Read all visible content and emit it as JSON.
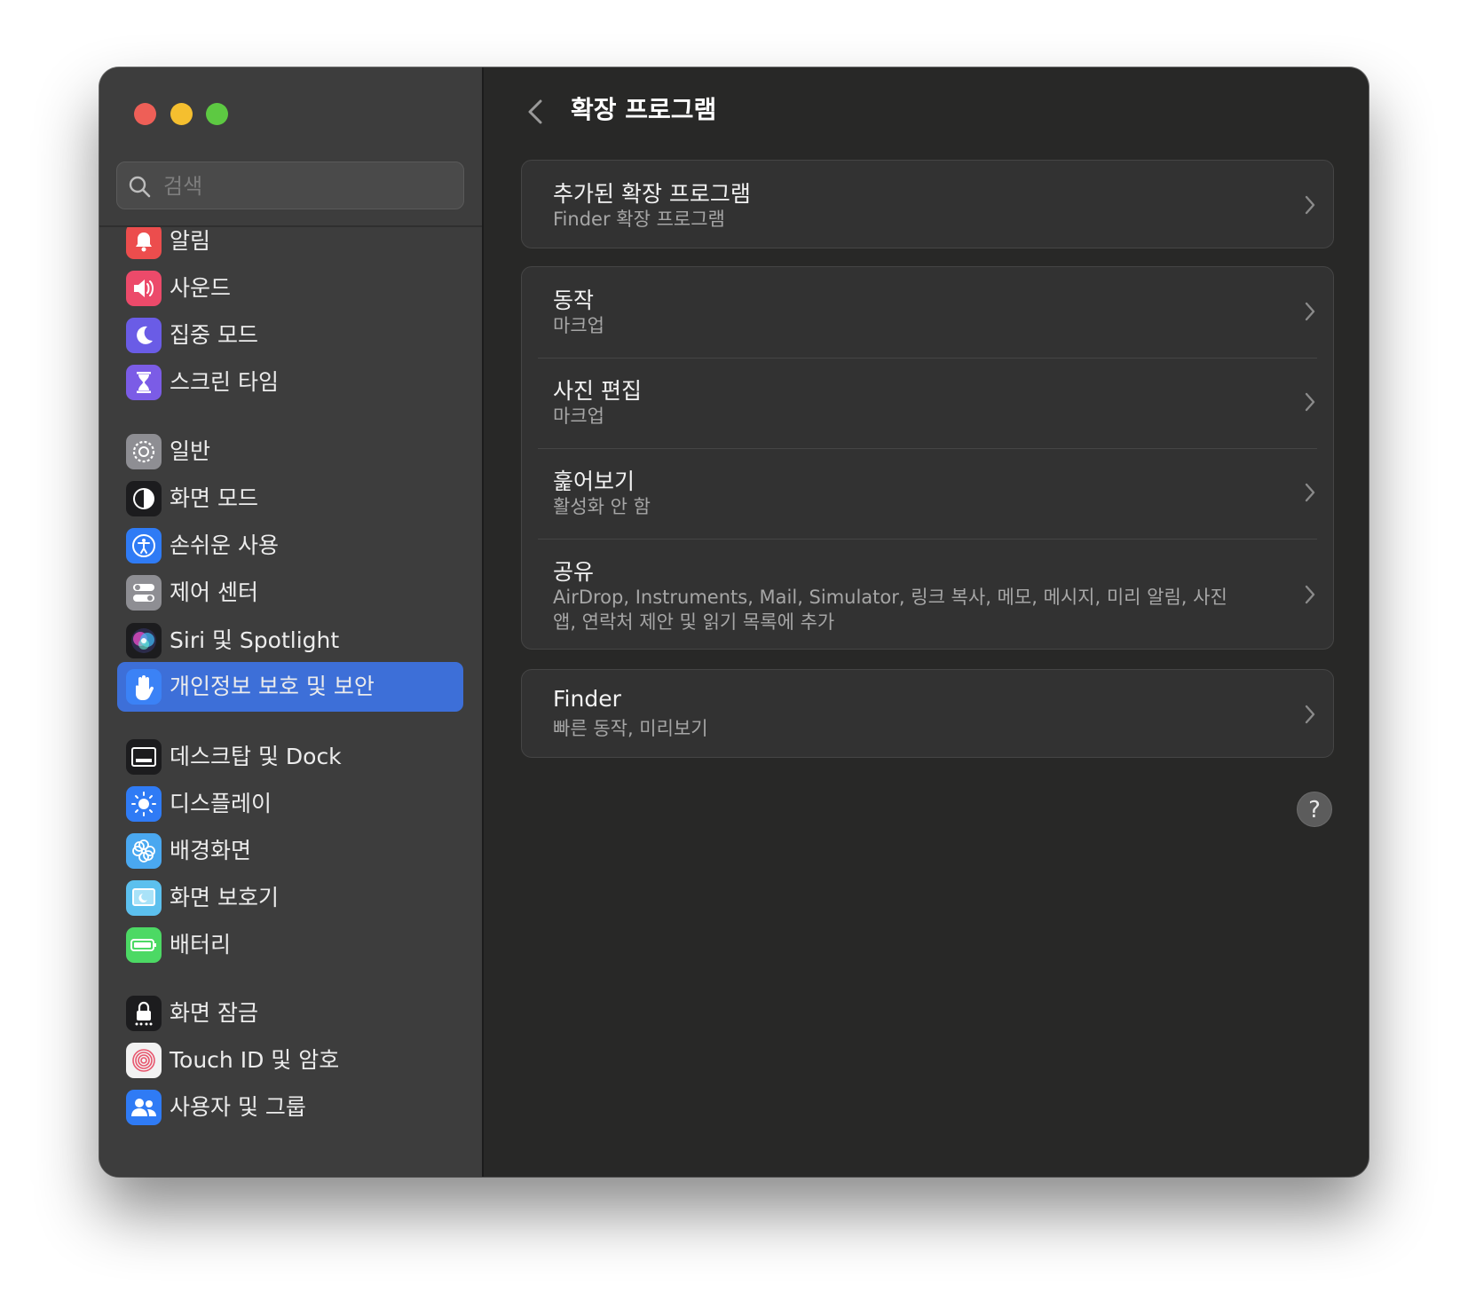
{
  "search": {
    "placeholder": "검색"
  },
  "sidebar": {
    "items": [
      {
        "label": "알림",
        "icon": "bell-icon",
        "icon_bg": "#ec4d4d"
      },
      {
        "label": "사운드",
        "icon": "speaker-icon",
        "icon_bg": "#ec4a6a"
      },
      {
        "label": "집중 모드",
        "icon": "moon-icon",
        "icon_bg": "#6a5ce6"
      },
      {
        "label": "스크린 타임",
        "icon": "hourglass-icon",
        "icon_bg": "#7b5ce6"
      },
      {
        "label": "일반",
        "icon": "gear-icon",
        "icon_bg": "#8e8e93"
      },
      {
        "label": "화면 모드",
        "icon": "appearance-icon",
        "icon_bg": "#1c1c1e"
      },
      {
        "label": "손쉬운 사용",
        "icon": "accessibility-icon",
        "icon_bg": "#2f7bf5"
      },
      {
        "label": "제어 센터",
        "icon": "toggles-icon",
        "icon_bg": "#8e8e93"
      },
      {
        "label": "Siri 및 Spotlight",
        "icon": "siri-icon",
        "icon_bg": "#1c1c1e"
      },
      {
        "label": "개인정보 보호 및 보안",
        "icon": "hand-icon",
        "icon_bg": "#3b82f6",
        "selected": true
      },
      {
        "label": "데스크탑 및 Dock",
        "icon": "dock-icon",
        "icon_bg": "#1c1c1e"
      },
      {
        "label": "디스플레이",
        "icon": "sun-icon",
        "icon_bg": "#2f7bf5"
      },
      {
        "label": "배경화면",
        "icon": "flower-icon",
        "icon_bg": "#4aa8f0"
      },
      {
        "label": "화면 보호기",
        "icon": "screensaver-icon",
        "icon_bg": "#5cc0ee"
      },
      {
        "label": "배터리",
        "icon": "battery-icon",
        "icon_bg": "#4cd964"
      },
      {
        "label": "화면 잠금",
        "icon": "lock-icon",
        "icon_bg": "#1c1c1e"
      },
      {
        "label": "Touch ID 및 암호",
        "icon": "fingerprint-icon",
        "icon_bg": "#f2f2f2"
      },
      {
        "label": "사용자 및 그룹",
        "icon": "users-icon",
        "icon_bg": "#2f7bf5"
      }
    ]
  },
  "header": {
    "title": "확장 프로그램"
  },
  "cards": {
    "added": {
      "title": "추가된 확장 프로그램",
      "subtitle": "Finder 확장 프로그램"
    },
    "group": [
      {
        "title": "동작",
        "subtitle": "마크업"
      },
      {
        "title": "사진 편집",
        "subtitle": "마크업"
      },
      {
        "title": "훑어보기",
        "subtitle": "활성화 안 함"
      },
      {
        "title": "공유",
        "subtitle": "AirDrop, Instruments, Mail, Simulator, 링크 복사, 메모, 메시지, 미리 알림, 사진 앱, 연락처 제안 및 읽기 목록에 추가"
      }
    ],
    "finder": {
      "title": "Finder",
      "subtitle": "빠른 동작, 미리보기"
    }
  },
  "help": {
    "label": "?"
  }
}
